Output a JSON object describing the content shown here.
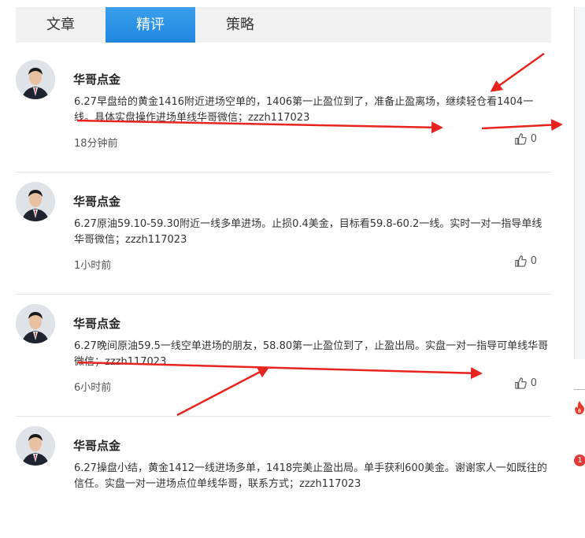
{
  "tabs": [
    {
      "label": "文章"
    },
    {
      "label": "精评"
    },
    {
      "label": "策略"
    }
  ],
  "active_tab_index": 1,
  "posts": [
    {
      "author": "华哥点金",
      "text": "6.27早盘给的黄金1416附近进场空单的，1406第一止盈位到了，准备止盈离场，继续轻仓看1404一线。具体实盘操作进场单线华哥微信；zzzh117023",
      "time": "18分钟前",
      "likes": "0"
    },
    {
      "author": "华哥点金",
      "text": "6.27原油59.10-59.30附近一线多单进场。止损0.4美金，目标看59.8-60.2一线。实时一对一指导单线华哥微信；zzzh117023",
      "time": "1小时前",
      "likes": "0"
    },
    {
      "author": "华哥点金",
      "text": "6.27晚间原油59.5一线空单进场的朋友，58.80第一止盈位到了，止盈出局。实盘一对一指导可单线华哥微信；zzzh117023",
      "time": "6小时前",
      "likes": "0"
    },
    {
      "author": "华哥点金",
      "text": "6.27操盘小结，黄金1412一线进场多单，1418完美止盈出局。单手获利600美金。谢谢家人一如既往的信任。实盘一对一进场点位单线华哥，联系方式；zzzh117023",
      "time": "",
      "likes": ""
    }
  ],
  "sidebar": {
    "badge": "1"
  },
  "icons": {
    "like": "thumbs-up-icon",
    "avatar": "avatar",
    "fire": "fire-icon",
    "annotation": "red-arrow"
  },
  "colors": {
    "tab_active": "#2a8fe6",
    "tab_bg": "#f1f1f1",
    "annotation_red": "#e8241e",
    "badge_red": "#e03a3a"
  }
}
